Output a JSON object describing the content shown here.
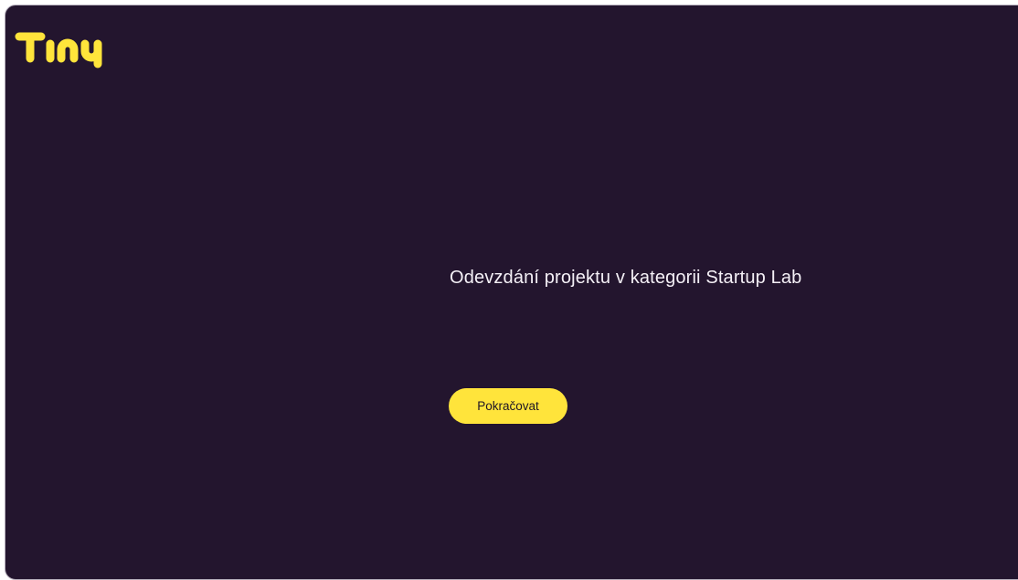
{
  "app": {
    "logo_text": "Tiny",
    "brand_color": "#ffe43b",
    "background_color": "#23152e"
  },
  "main": {
    "heading": "Odevzdání projektu v kategorii Startup Lab",
    "continue_label": "Pokračovat"
  }
}
